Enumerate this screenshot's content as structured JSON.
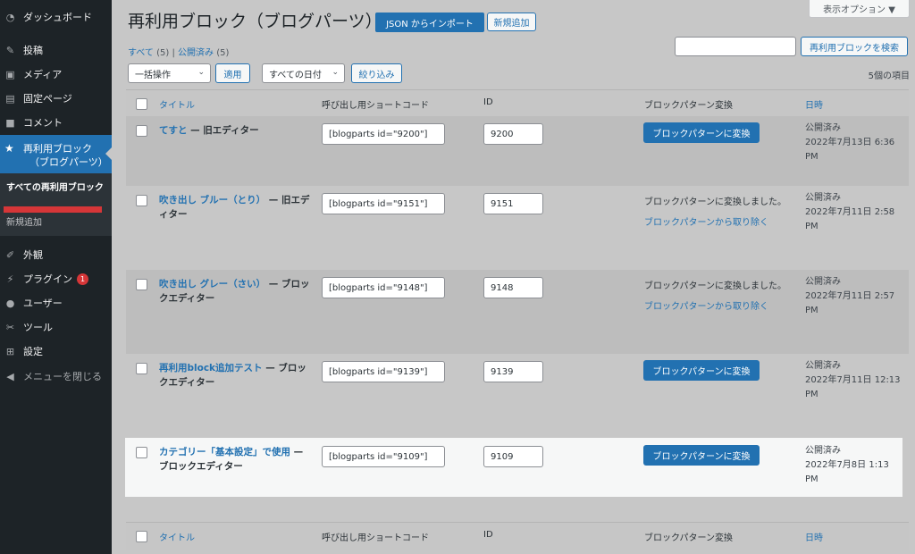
{
  "sidebar": {
    "items": [
      {
        "label": "ダッシュボード",
        "icon": "dashboard-icon"
      },
      {
        "label": "投稿",
        "icon": "pin-icon"
      },
      {
        "label": "メディア",
        "icon": "media-icon"
      },
      {
        "label": "固定ページ",
        "icon": "page-icon"
      },
      {
        "label": "コメント",
        "icon": "comment-icon"
      }
    ],
    "current": {
      "label_line1": "再利用ブロック",
      "label_line2": "（ブログパーツ）",
      "icon": "star-icon"
    },
    "submenu": {
      "current": "すべての再利用ブロック",
      "new": "新規追加"
    },
    "items2": [
      {
        "label": "外観",
        "icon": "brush-icon"
      },
      {
        "label": "プラグイン",
        "icon": "plugin-icon",
        "badge": "1"
      },
      {
        "label": "ユーザー",
        "icon": "user-icon"
      },
      {
        "label": "ツール",
        "icon": "wrench-icon"
      },
      {
        "label": "設定",
        "icon": "settings-icon"
      },
      {
        "label": "メニューを閉じる",
        "icon": "collapse-icon"
      }
    ]
  },
  "header": {
    "title": "再利用ブロック（ブログパーツ）",
    "import_button": "JSON からインポート",
    "add_new_button": "新規追加",
    "screen_options": "表示オプション ▼"
  },
  "filters": {
    "all": "すべて",
    "all_count": "(5)",
    "separator": "|",
    "published": "公開済み",
    "published_count": "(5)",
    "search_button": "再利用ブロックを検索",
    "bulk_action": "一括操作",
    "apply": "適用",
    "all_dates": "すべての日付",
    "filter": "絞り込み",
    "items_count": "5個の項目"
  },
  "table": {
    "headers": {
      "title": "タイトル",
      "shortcode": "呼び出し用ショートコード",
      "id": "ID",
      "convert": "ブロックパターン変換",
      "date": "日時"
    },
    "rows": [
      {
        "title": "てすと",
        "suffix": " — 旧エディター",
        "shortcode": "[blogparts id=\"9200\"]",
        "id": "9200",
        "convert_button": "ブロックパターンに変換",
        "date_status": "公開済み",
        "date": "2022年7月13日 6:36 PM"
      },
      {
        "title": "吹き出し ブルー（とり）",
        "suffix": " — 旧エディター",
        "shortcode": "[blogparts id=\"9151\"]",
        "id": "9151",
        "convert_text": "ブロックパターンに変換しました。",
        "convert_link": "ブロックパターンから取り除く",
        "date_status": "公開済み",
        "date": "2022年7月11日 2:58 PM"
      },
      {
        "title": "吹き出し グレー（さい）",
        "suffix": " — ブロックエディター",
        "shortcode": "[blogparts id=\"9148\"]",
        "id": "9148",
        "convert_text": "ブロックパターンに変換しました。",
        "convert_link": "ブロックパターンから取り除く",
        "date_status": "公開済み",
        "date": "2022年7月11日 2:57 PM"
      },
      {
        "title": "再利用block追加テスト",
        "suffix": " — ブロックエディター",
        "shortcode": "[blogparts id=\"9139\"]",
        "id": "9139",
        "convert_button": "ブロックパターンに変換",
        "date_status": "公開済み",
        "date": "2022年7月11日 12:13 PM"
      },
      {
        "title": "カテゴリー「基本設定」で使用",
        "suffix": " — ブロックエディター",
        "shortcode": "[blogparts id=\"9109\"]",
        "id": "9109",
        "convert_button": "ブロックパターンに変換",
        "date_status": "公開済み",
        "date": "2022年7月8日 1:13 PM"
      }
    ]
  },
  "colors": {
    "accent": "#2271b1",
    "sidebar_bg": "#1d2327",
    "current_menu": "#2271b1",
    "badge": "#d63638",
    "highlight_row": "#f6f7f7"
  }
}
